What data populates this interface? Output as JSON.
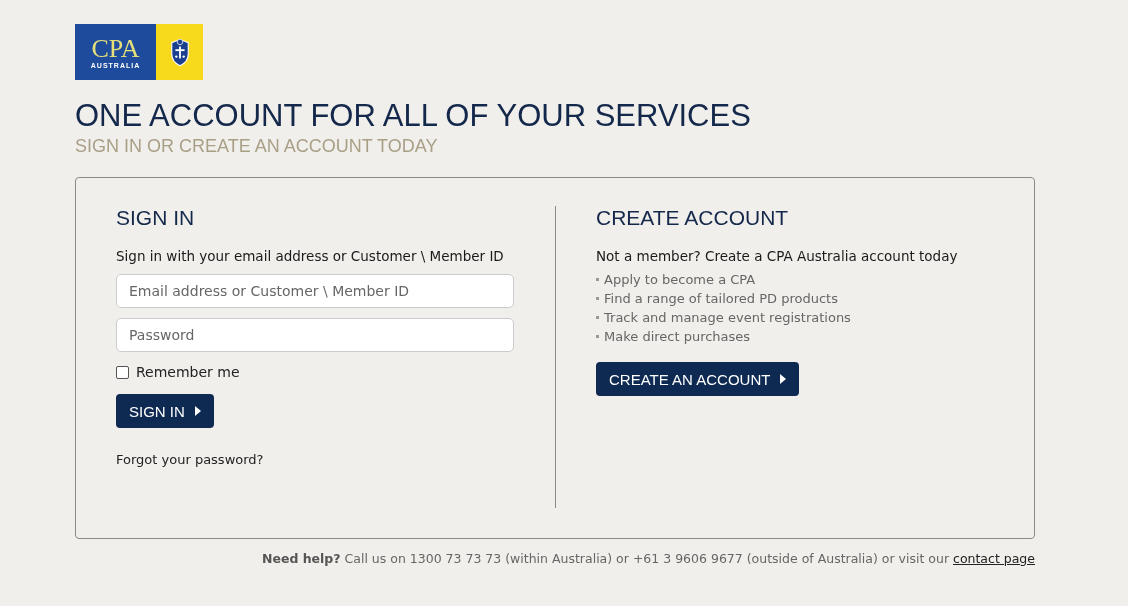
{
  "logo": {
    "name": "CPA",
    "subtitle": "AUSTRALIA"
  },
  "heading": "ONE ACCOUNT FOR ALL OF YOUR SERVICES",
  "subheading": "SIGN IN OR CREATE AN ACCOUNT TODAY",
  "sign_in": {
    "title": "SIGN IN",
    "intro": "Sign in with your email address or Customer \\ Member ID",
    "fields": [
      {
        "placeholder": "Email address or Customer \\ Member ID"
      },
      {
        "placeholder": "Password"
      }
    ],
    "remember": {
      "label": "Remember me",
      "checked": false
    },
    "button": "SIGN IN",
    "forgot": "Forgot your password?"
  },
  "create": {
    "title": "CREATE ACCOUNT",
    "intro": "Not a member? Create a CPA Australia account today",
    "benefits": [
      "Apply to become a CPA",
      "Find a range of tailored PD products",
      "Track and manage event registrations",
      "Make direct purchases"
    ],
    "button": "CREATE AN ACCOUNT"
  },
  "footer": {
    "text": "**Need help?** Call us on 1300 73 73 73 (within Australia) or +61 3 9606 9677 (outside of Australia) or visit our",
    "link": "contact page"
  }
}
